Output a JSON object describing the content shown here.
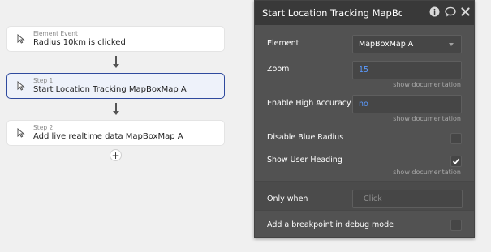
{
  "workflow": {
    "cards": [
      {
        "kind": "Element Event",
        "label": "Radius 10km is clicked",
        "icon": "cursor-icon"
      },
      {
        "kind": "Step 1",
        "label": "Start Location Tracking MapBoxMap A",
        "icon": "cursor-icon"
      },
      {
        "kind": "Step 2",
        "label": "Add live realtime data MapBoxMap A",
        "icon": "cursor-icon"
      }
    ],
    "add_button": "+"
  },
  "panel": {
    "title": "Start Location Tracking MapBoxM",
    "icons": [
      "info-icon",
      "comment-icon",
      "close-icon"
    ],
    "element_label": "Element",
    "element_value": "MapBoxMap A",
    "zoom_label": "Zoom",
    "zoom_value": "15",
    "show_doc": "show documentation",
    "high_accuracy_label": "Enable High Accuracy",
    "high_accuracy_value": "no",
    "disable_blue_radius_label": "Disable Blue Radius",
    "disable_blue_radius_checked": false,
    "show_user_heading_label": "Show User Heading",
    "show_user_heading_checked": true,
    "only_when_label": "Only when",
    "only_when_placeholder": "Click",
    "breakpoint_label": "Add a breakpoint in debug mode",
    "breakpoint_checked": false
  },
  "colors": {
    "active_border": "#2f4a9e",
    "panel_bg": "#525252",
    "header_bg": "#393939",
    "value_blue": "#5b9bff"
  }
}
